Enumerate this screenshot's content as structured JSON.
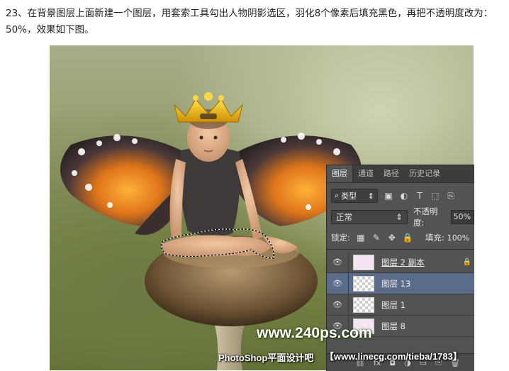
{
  "caption": "23、在背景图层上面新建一个图层，用套索工具勾出人物阴影选区，羽化8个像素后填充黑色，再把不透明度改为：50%，效果如下图。",
  "layers_panel": {
    "tabs": [
      "图层",
      "通道",
      "路径",
      "历史记录"
    ],
    "filter": {
      "label": "类型"
    },
    "blend_mode": "正常",
    "opacity_label": "不透明度:",
    "opacity_value": "50%",
    "lock_label": "锁定:",
    "fill_label": "填充:",
    "fill_value": "100%",
    "layers": [
      {
        "name": "图层 2 副本",
        "selected": false
      },
      {
        "name": "图层 13",
        "selected": true
      },
      {
        "name": "图层 1",
        "selected": false
      },
      {
        "name": "图层 8",
        "selected": false
      }
    ]
  },
  "watermarks": {
    "site": "www.240ps.com",
    "forum_label": "PhotoShop平面设计吧",
    "forum_url": "【www.linecg.com/tieba/1783】"
  }
}
